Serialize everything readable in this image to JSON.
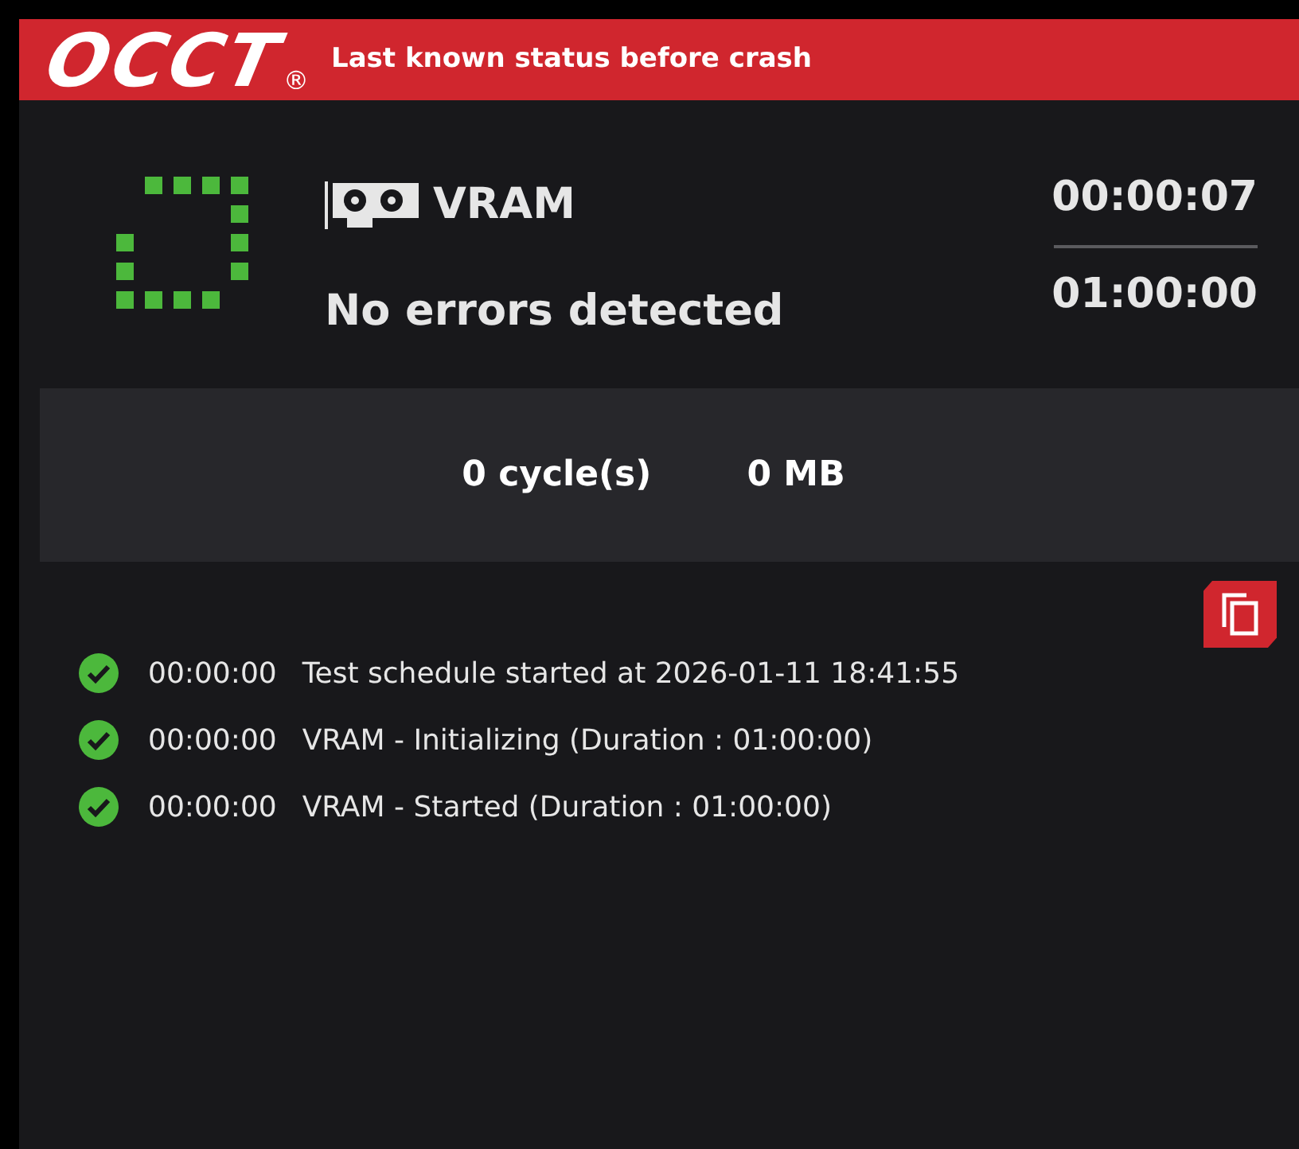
{
  "header": {
    "logo": "OCCT",
    "registered_mark": "®",
    "title": "Last known status before crash"
  },
  "test": {
    "name": "VRAM",
    "status": "No errors detected",
    "elapsed": "00:00:07",
    "duration": "01:00:00"
  },
  "stats": [
    "0 cycle(s)",
    "0 MB"
  ],
  "log": [
    {
      "time": "00:00:00",
      "message": "Test schedule started at 2026-01-11 18:41:55",
      "kind": "ok"
    },
    {
      "time": "00:00:00",
      "message": "VRAM - Initializing (Duration : 01:00:00)",
      "kind": "ok"
    },
    {
      "time": "00:00:00",
      "message": "VRAM - Started (Duration : 01:00:00)",
      "kind": "ok"
    }
  ]
}
